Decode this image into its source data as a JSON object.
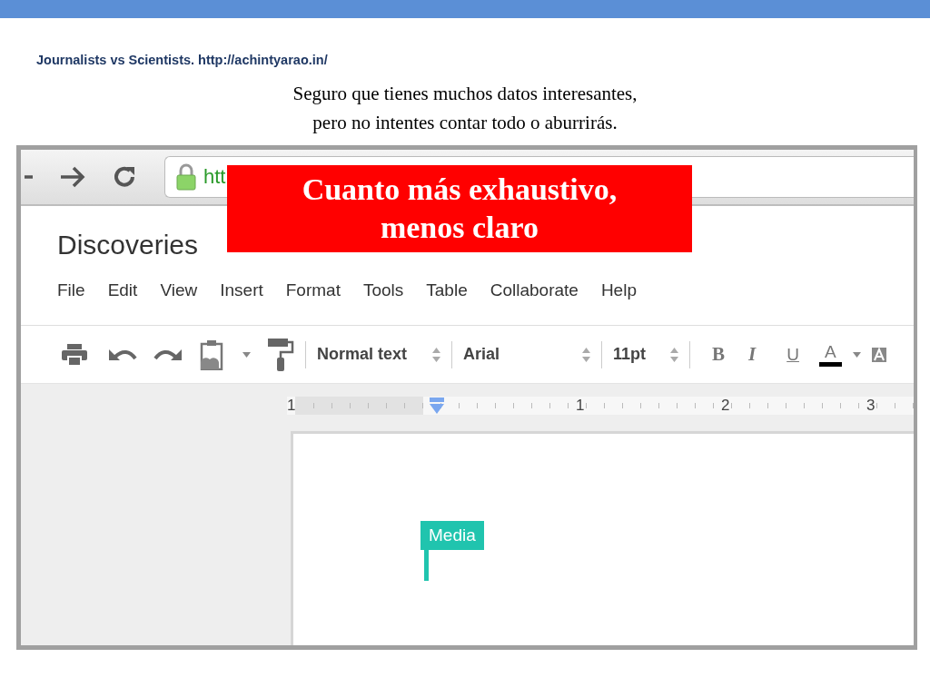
{
  "slide": {
    "source": "Journalists vs Scientists. http://achintyarao.in/",
    "caption": [
      "Seguro que tienes muchos datos interesantes,",
      "pero no intentes contar todo o aburrirás."
    ]
  },
  "browser": {
    "url": "htt"
  },
  "callout": {
    "lines": [
      "Cuanto más exhaustivo,",
      "menos claro"
    ]
  },
  "doc": {
    "title": "Discoveries",
    "menu": [
      "File",
      "Edit",
      "View",
      "Insert",
      "Format",
      "Tools",
      "Table",
      "Collaborate",
      "Help"
    ],
    "toolbar": {
      "style": "Normal text",
      "font": "Arial",
      "size": "11pt",
      "bold": "B",
      "italic": "I",
      "underline": "U",
      "text_color": "A"
    },
    "ruler": [
      "1",
      "1",
      "2",
      "3"
    ],
    "tag": "Media"
  }
}
